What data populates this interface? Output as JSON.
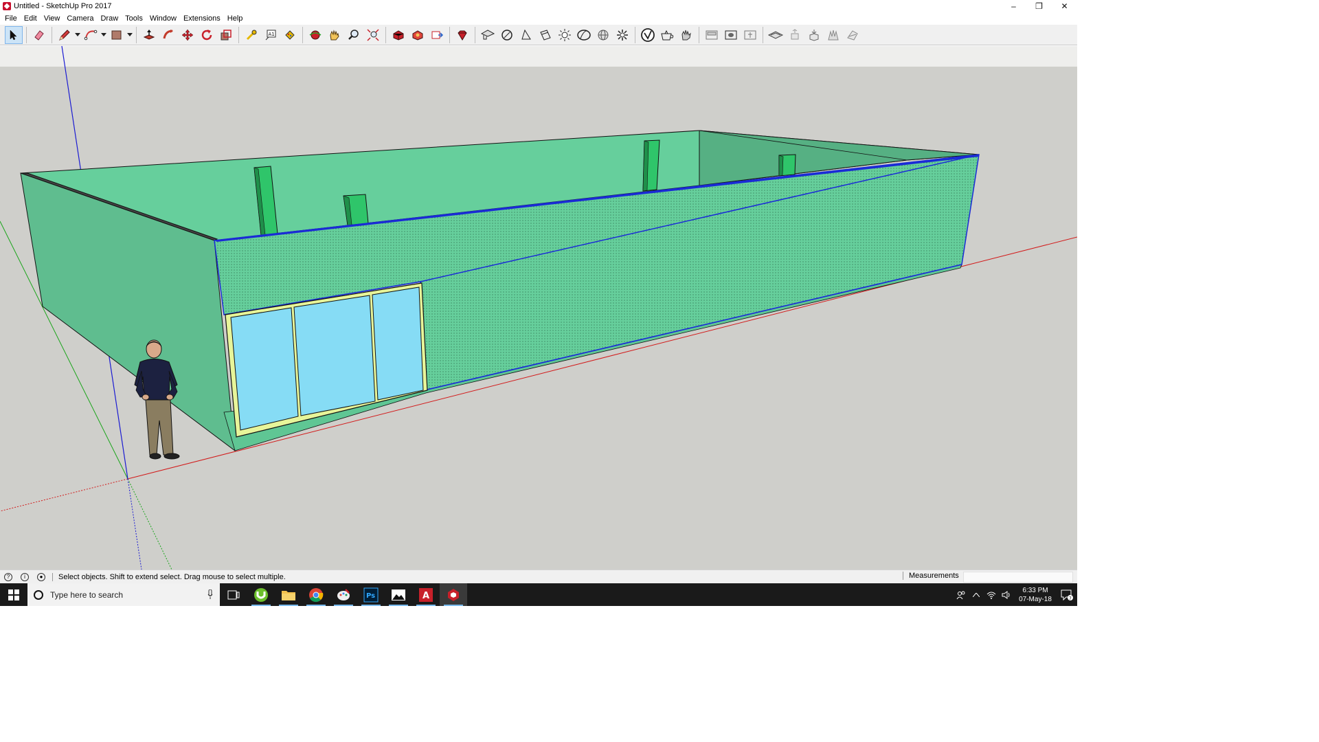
{
  "window": {
    "title": "Untitled - SketchUp Pro 2017",
    "controls": {
      "minimize": "–",
      "restore": "❐",
      "close": "✕"
    }
  },
  "menu": [
    "File",
    "Edit",
    "View",
    "Camera",
    "Draw",
    "Tools",
    "Window",
    "Extensions",
    "Help"
  ],
  "toolbar": {
    "tools": [
      {
        "name": "select-tool",
        "icon": "arrow-cursor-icon",
        "active": true
      },
      {
        "name": "eraser-tool",
        "icon": "eraser-icon"
      },
      {
        "name": "line-tool",
        "icon": "pencil-icon"
      },
      {
        "name": "arc-tool",
        "icon": "arc-icon"
      },
      {
        "name": "rectangle-tool",
        "icon": "rectangle-icon"
      },
      {
        "name": "push-pull-tool",
        "icon": "push-pull-icon"
      },
      {
        "name": "follow-me-tool",
        "icon": "follow-me-icon"
      },
      {
        "name": "move-tool",
        "icon": "move-icon"
      },
      {
        "name": "rotate-tool",
        "icon": "rotate-icon"
      },
      {
        "name": "scale-tool",
        "icon": "scale-icon"
      },
      {
        "name": "offset-tool",
        "icon": "offset-icon"
      },
      {
        "name": "tape-measure-tool",
        "icon": "tape-measure-icon"
      },
      {
        "name": "text-tool",
        "icon": "text-icon"
      },
      {
        "name": "paint-bucket-tool",
        "icon": "paint-bucket-icon"
      },
      {
        "name": "orbit-tool",
        "icon": "orbit-icon"
      },
      {
        "name": "pan-tool",
        "icon": "pan-hand-icon"
      },
      {
        "name": "zoom-tool",
        "icon": "zoom-icon"
      },
      {
        "name": "zoom-extents-tool",
        "icon": "zoom-extents-icon"
      },
      {
        "name": "3d-warehouse",
        "icon": "warehouse-icon"
      },
      {
        "name": "extension-warehouse",
        "icon": "extension-warehouse-icon"
      },
      {
        "name": "send-to-layout",
        "icon": "layout-icon"
      },
      {
        "name": "extension-manager",
        "icon": "ruby-gem-icon"
      },
      {
        "name": "style-xray",
        "icon": "xray-icon"
      },
      {
        "name": "style-back-edges",
        "icon": "back-edges-icon"
      },
      {
        "name": "style-wireframe",
        "icon": "wireframe-icon"
      },
      {
        "name": "style-hidden-line",
        "icon": "hidden-line-icon"
      },
      {
        "name": "style-shaded",
        "icon": "shaded-icon"
      },
      {
        "name": "style-shaded-textures",
        "icon": "shaded-textures-icon"
      },
      {
        "name": "style-monochrome",
        "icon": "monochrome-icon"
      },
      {
        "name": "shadows",
        "icon": "sun-icon"
      },
      {
        "name": "view-iso",
        "icon": "iso-view-icon"
      },
      {
        "name": "view-top",
        "icon": "top-view-icon"
      },
      {
        "name": "view-front",
        "icon": "front-view-icon"
      },
      {
        "name": "section-plane",
        "icon": "section-plane-icon"
      },
      {
        "name": "display-section-planes",
        "icon": "display-section-icon"
      },
      {
        "name": "display-section-cuts",
        "icon": "section-cuts-icon"
      },
      {
        "name": "sandbox-from-contours",
        "icon": "sandbox-icon"
      },
      {
        "name": "sandbox-smoove",
        "icon": "smoove-icon"
      },
      {
        "name": "sandbox-stamp",
        "icon": "stamp-icon"
      },
      {
        "name": "sandbox-drape",
        "icon": "drape-icon"
      },
      {
        "name": "sandbox-add-detail",
        "icon": "add-detail-icon"
      }
    ]
  },
  "viewport": {
    "colors": {
      "ground": "#cfcfcb",
      "sky": "#eeeeec",
      "wall": "#66cf9c",
      "wall_dark": "#58b387",
      "glass": "#86dcf5",
      "frame": "#e7f59a",
      "pillar": "#2fc56a",
      "selection": "#1a2bd6",
      "axis_red": "#d21a1a",
      "axis_green": "#1aa51a",
      "axis_blue": "#1a1ad2"
    },
    "entities": [
      "building-walls",
      "window-assembly",
      "interior-pillars",
      "scale-figure"
    ]
  },
  "status": {
    "hint": "Select objects. Shift to extend select. Drag mouse to select multiple.",
    "measurements_label": "Measurements",
    "measurements_value": ""
  },
  "taskbar": {
    "search_placeholder": "Type here to search",
    "apps": [
      {
        "name": "task-view",
        "icon": "task-view-icon"
      },
      {
        "name": "utorrent",
        "icon": "utorrent-icon"
      },
      {
        "name": "file-explorer",
        "icon": "folder-icon"
      },
      {
        "name": "chrome",
        "icon": "chrome-icon"
      },
      {
        "name": "paint",
        "icon": "paint-icon"
      },
      {
        "name": "photoshop",
        "icon": "photoshop-icon",
        "label": "Ps"
      },
      {
        "name": "photos",
        "icon": "photos-icon"
      },
      {
        "name": "autocad",
        "icon": "autocad-icon",
        "label": "A"
      },
      {
        "name": "sketchup",
        "icon": "sketchup-icon",
        "active": true
      }
    ],
    "time": "6:33 PM",
    "date": "07-May-18",
    "notification_count": "7"
  }
}
